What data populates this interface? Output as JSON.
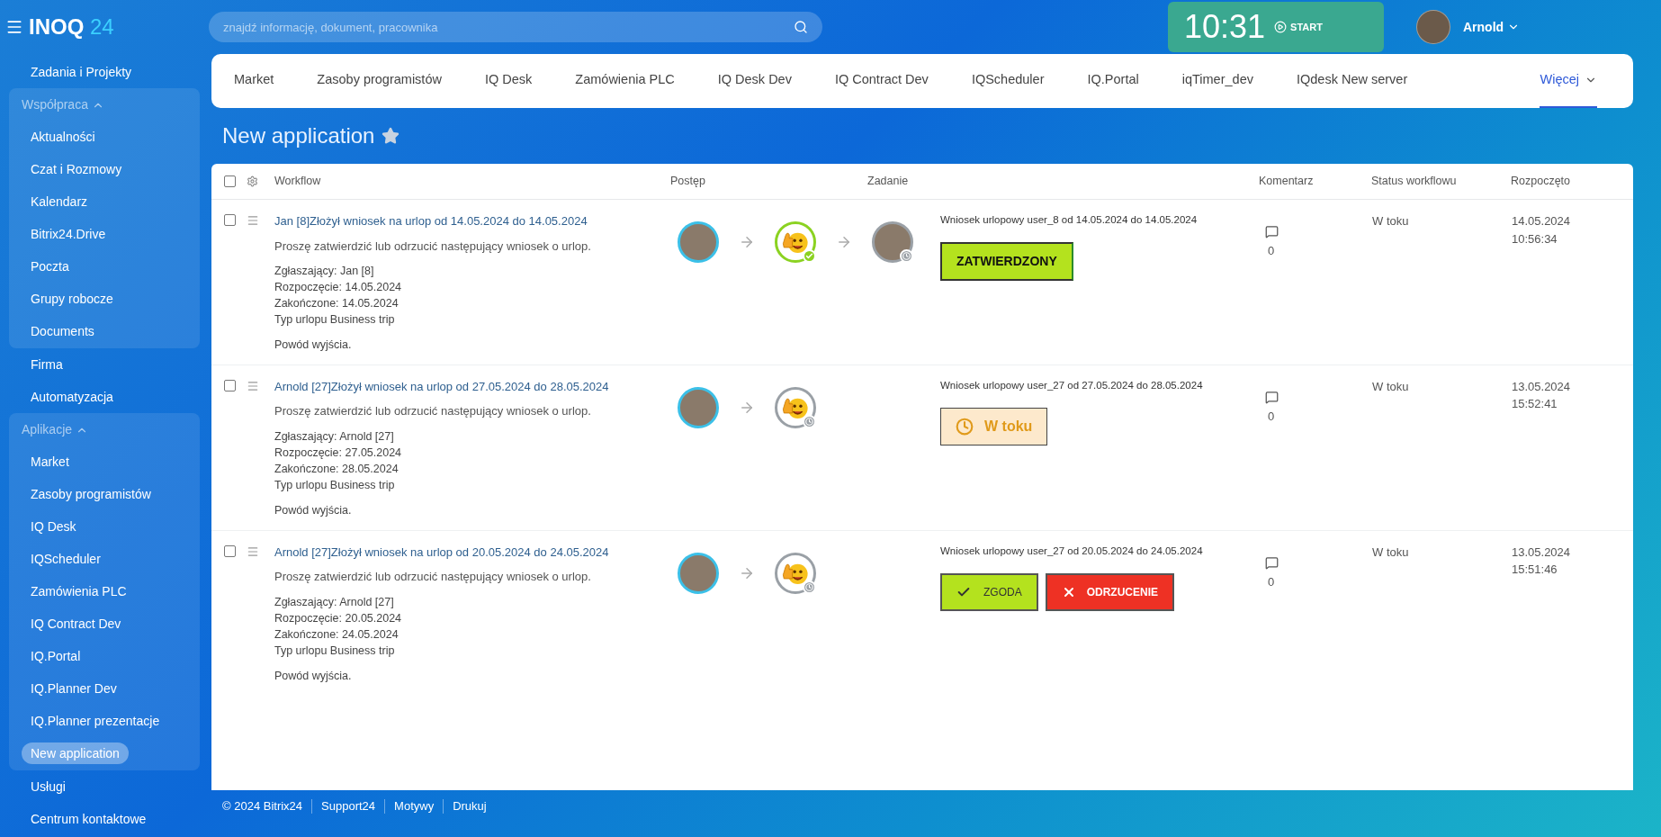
{
  "logo": {
    "name": "INOQ",
    "number": "24"
  },
  "search": {
    "placeholder": "znajdź informację, dokument, pracownika"
  },
  "timer": {
    "time": "10:31",
    "action": "START"
  },
  "user": {
    "name": "Arnold"
  },
  "sidebar": [
    {
      "kind": "link",
      "label": "Zadania i Projekty",
      "selected": false
    },
    {
      "kind": "group",
      "label": "Współpraca",
      "expanded": true,
      "children": [
        {
          "label": "Aktualności",
          "selected": false
        },
        {
          "label": "Czat i Rozmowy",
          "selected": false
        },
        {
          "label": "Kalendarz",
          "selected": false
        },
        {
          "label": "Bitrix24.Drive",
          "selected": false
        },
        {
          "label": "Poczta",
          "selected": false
        },
        {
          "label": "Grupy robocze",
          "selected": false
        },
        {
          "label": "Documents",
          "selected": false
        }
      ]
    },
    {
      "kind": "link",
      "label": "Firma",
      "selected": false
    },
    {
      "kind": "link",
      "label": "Automatyzacja",
      "selected": false
    },
    {
      "kind": "group",
      "label": "Aplikacje",
      "expanded": true,
      "children": [
        {
          "label": "Market",
          "selected": false
        },
        {
          "label": "Zasoby programistów",
          "selected": false
        },
        {
          "label": "IQ Desk",
          "selected": false
        },
        {
          "label": "IQScheduler",
          "selected": false
        },
        {
          "label": "Zamówienia PLC",
          "selected": false
        },
        {
          "label": "IQ Contract Dev",
          "selected": false
        },
        {
          "label": "IQ.Portal",
          "selected": false
        },
        {
          "label": "IQ.Planner Dev",
          "selected": false
        },
        {
          "label": "IQ.Planner prezentacje",
          "selected": false
        },
        {
          "label": "New application",
          "selected": true
        }
      ]
    },
    {
      "kind": "link",
      "label": "Usługi",
      "selected": false
    },
    {
      "kind": "link",
      "label": "Centrum kontaktowe",
      "selected": false
    }
  ],
  "tabs": [
    {
      "label": "Market",
      "selected": false
    },
    {
      "label": "Zasoby programistów",
      "selected": false
    },
    {
      "label": "IQ Desk",
      "selected": false
    },
    {
      "label": "Zamówienia PLC",
      "selected": false
    },
    {
      "label": "IQ Desk Dev",
      "selected": false
    },
    {
      "label": "IQ Contract Dev",
      "selected": false
    },
    {
      "label": "IQScheduler",
      "selected": false
    },
    {
      "label": "IQ.Portal",
      "selected": false
    },
    {
      "label": "iqTimer_dev",
      "selected": false
    },
    {
      "label": "IQdesk New server",
      "selected": false
    }
  ],
  "more_tab": {
    "label": "Więcej",
    "selected": true
  },
  "page_title": {
    "text": "New application",
    "starred": false
  },
  "table": {
    "select_all": {
      "checked": false
    },
    "columns": [
      "Workflow",
      "Postęp",
      "Zadanie",
      "Komentarz",
      "Status workflowu",
      "Rozpoczęto"
    ],
    "rows": [
      {
        "checked": false,
        "title": "Jan [8]Złożył wniosek na urlop od 14.05.2024 do 14.05.2024",
        "message": "Proszę zatwierdzić lub odrzucić następujący wniosek o urlop.",
        "details": [
          "Zgłaszający: Jan [8]",
          "Rozpoczęcie: 14.05.2024",
          "Zakończone: 14.05.2024",
          "Typ urlopu Business trip"
        ],
        "reason": "Powód wyjścia.",
        "progress": [
          {
            "kind": "photo",
            "done": false,
            "waiting": false
          },
          {
            "kind": "emoji",
            "done": true,
            "waiting": false
          },
          {
            "kind": "photo",
            "done": false,
            "waiting": true
          }
        ],
        "task": {
          "title": "Wniosek urlopowy user_8 od 14.05.2024 do 14.05.2024",
          "actions": [
            {
              "kind": "approved",
              "label": "ZATWIERDZONY"
            }
          ]
        },
        "comments": "0",
        "status": "W toku",
        "started_date": "14.05.2024",
        "started_time": "10:56:34"
      },
      {
        "checked": false,
        "title": "Arnold [27]Złożył wniosek na urlop od 27.05.2024 do 28.05.2024",
        "message": "Proszę zatwierdzić lub odrzucić następujący wniosek o urlop.",
        "details": [
          "Zgłaszający: Arnold [27]",
          "Rozpoczęcie: 27.05.2024",
          "Zakończone: 28.05.2024",
          "Typ urlopu Business trip"
        ],
        "reason": "Powód wyjścia.",
        "progress": [
          {
            "kind": "photo",
            "done": false,
            "waiting": false
          },
          {
            "kind": "emoji",
            "done": false,
            "waiting": true
          }
        ],
        "task": {
          "title": "Wniosek urlopowy user_27 od 27.05.2024 do 28.05.2024",
          "actions": [
            {
              "kind": "pending",
              "label": "W toku"
            }
          ]
        },
        "comments": "0",
        "status": "W toku",
        "started_date": "13.05.2024",
        "started_time": "15:52:41"
      },
      {
        "checked": false,
        "title": "Arnold [27]Złożył wniosek na urlop od 20.05.2024 do 24.05.2024",
        "message": "Proszę zatwierdzić lub odrzucić następujący wniosek o urlop.",
        "details": [
          "Zgłaszający: Arnold [27]",
          "Rozpoczęcie: 20.05.2024",
          "Zakończone: 24.05.2024",
          "Typ urlopu Business trip"
        ],
        "reason": "Powód wyjścia.",
        "progress": [
          {
            "kind": "photo",
            "done": false,
            "waiting": false
          },
          {
            "kind": "emoji",
            "done": false,
            "waiting": true
          }
        ],
        "task": {
          "title": "Wniosek urlopowy user_27 od 20.05.2024 do 24.05.2024",
          "actions": [
            {
              "kind": "approve",
              "label": "ZGODA"
            },
            {
              "kind": "reject",
              "label": "ODRZUCENIE"
            }
          ]
        },
        "comments": "0",
        "status": "W toku",
        "started_date": "13.05.2024",
        "started_time": "15:51:46"
      }
    ]
  },
  "footer": [
    "© 2024 Bitrix24",
    "Support24",
    "Motywy",
    "Drukuj"
  ]
}
